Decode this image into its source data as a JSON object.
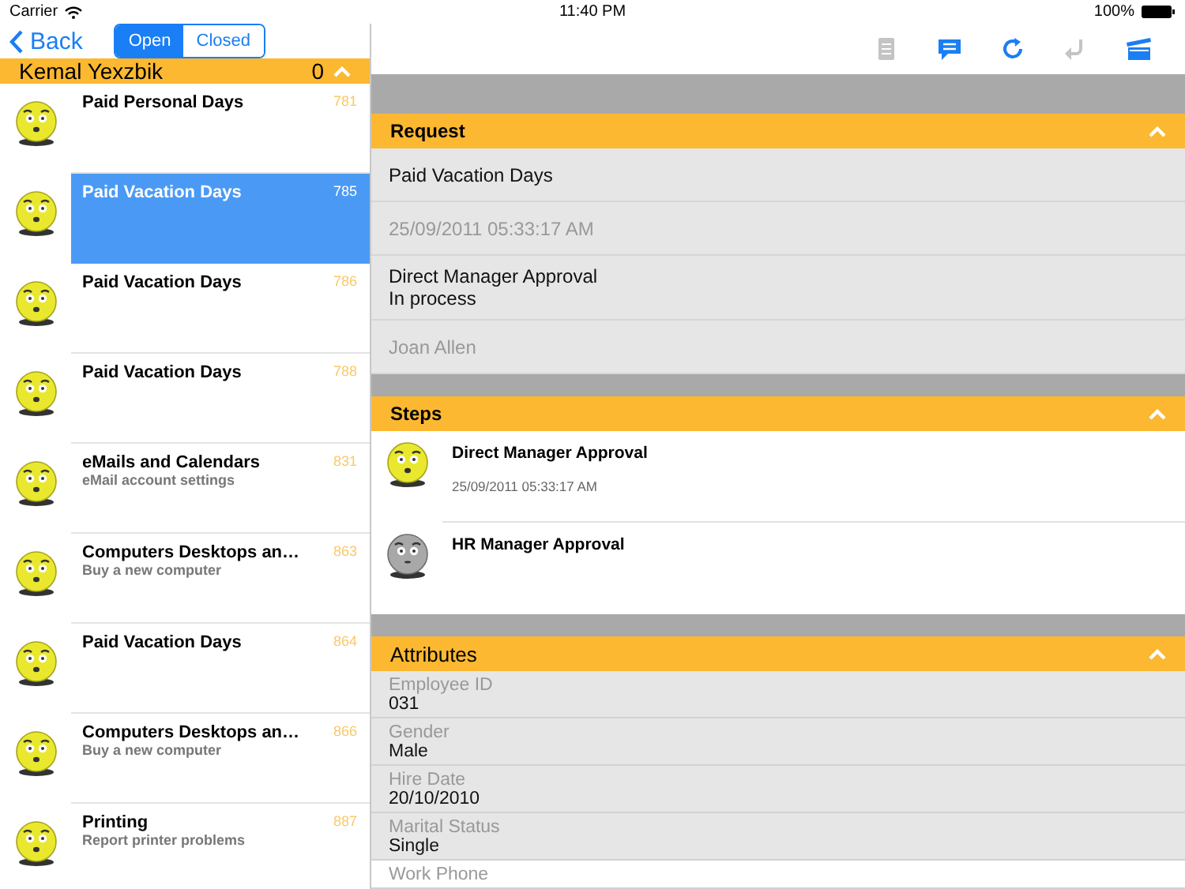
{
  "status_bar": {
    "carrier": "Carrier",
    "time": "11:40 PM",
    "battery": "100%"
  },
  "nav": {
    "back": "Back",
    "segments": [
      {
        "label": "Open",
        "selected": true
      },
      {
        "label": "Closed",
        "selected": false
      }
    ]
  },
  "toolbar": [
    {
      "kind": "document",
      "disabled": true
    },
    {
      "kind": "chat",
      "disabled": false
    },
    {
      "kind": "refresh",
      "disabled": false
    },
    {
      "kind": "undo",
      "disabled": true
    },
    {
      "kind": "clapper",
      "disabled": false
    }
  ],
  "group": {
    "name": "Kemal Yexzbik",
    "count": "0",
    "expanded": true
  },
  "requests": [
    {
      "title": "Paid Personal Days",
      "number": "781",
      "selected": false
    },
    {
      "title": "Paid Vacation Days",
      "number": "785",
      "selected": true
    },
    {
      "title": "Paid Vacation Days",
      "number": "786",
      "selected": false
    },
    {
      "title": "Paid Vacation Days",
      "number": "788",
      "selected": false
    },
    {
      "title": "eMails and Calendars",
      "subtitle": "eMail account settings",
      "number": "831",
      "selected": false
    },
    {
      "title": "Computers Desktops an…",
      "subtitle": "Buy a new computer",
      "number": "863",
      "selected": false
    },
    {
      "title": "Paid Vacation Days",
      "number": "864",
      "selected": false
    },
    {
      "title": "Computers Desktops an…",
      "subtitle": "Buy a new computer",
      "number": "866",
      "selected": false
    },
    {
      "title": "Printing",
      "subtitle": "Report printer problems",
      "number": "887",
      "selected": false
    }
  ],
  "request": {
    "title": "Request",
    "expanded": true,
    "rows": [
      {
        "kind": "primary",
        "lines": [
          "Paid Vacation Days"
        ]
      },
      {
        "kind": "muted",
        "lines": [
          "25/09/2011 05:33:17 AM"
        ]
      },
      {
        "kind": "primary",
        "lines": [
          "Direct Manager Approval",
          "In process"
        ]
      },
      {
        "kind": "muted",
        "lines": [
          "Joan Allen"
        ]
      }
    ]
  },
  "steps": {
    "title": "Steps",
    "expanded": true,
    "items": [
      {
        "name": "Direct Manager Approval",
        "date": "25/09/2011 05:33:17 AM",
        "completed": true
      },
      {
        "name": "HR Manager Approval",
        "completed": false
      }
    ]
  },
  "attributes": {
    "title": "Attributes",
    "expanded": true,
    "items": [
      {
        "label": "Employee ID",
        "value": "031"
      },
      {
        "label": "Gender",
        "value": "Male"
      },
      {
        "label": "Hire Date",
        "value": "20/10/2010"
      },
      {
        "label": "Marital Status",
        "value": "Single"
      },
      {
        "label": "Work Phone"
      }
    ]
  }
}
